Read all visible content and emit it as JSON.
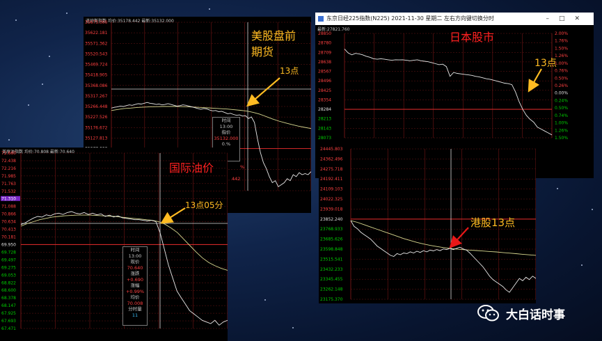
{
  "watermark": {
    "text": "大白话时事"
  },
  "colors": {
    "up": "#ff4040",
    "down": "#00d000",
    "price": "#e8e8e8",
    "avg": "#d8d890",
    "annotation": "#ffbb22",
    "arrow": "#ffbb22",
    "hk_arrow": "#e81818"
  },
  "chart_data": [
    {
      "id": "us_futures",
      "type": "line",
      "header": {
        "name": "道琼斯指数",
        "price_label": "均价:",
        "price": "35178.442",
        "latest_label": "最新:",
        "latest": "35132.000"
      },
      "annotation_title": "美股盘前期货",
      "annotation_title_lines": [
        "美股盘前",
        "期货"
      ],
      "annotation_marker": "13点",
      "y_ticks": [
        "35673.000",
        "35622.181",
        "35571.362",
        "35520.543",
        "35469.724",
        "35418.905",
        "35368.086",
        "35317.267",
        "35266.448",
        "35227.526",
        "35176.672",
        "35127.813",
        "35077.000",
        "35026.181",
        "34975.362",
        "34924.543",
        "34873.724"
      ],
      "reference_value": "35077.000",
      "ylim": [
        34850,
        35690
      ],
      "values": [
        35262,
        35266,
        35268,
        35272,
        35270,
        35274,
        35278,
        35276,
        35280,
        35284,
        35282,
        35286,
        35290,
        35286,
        35284,
        35280,
        35282,
        35278,
        35280,
        35284,
        35280,
        35276,
        35272,
        35274,
        35278,
        35276,
        35272,
        35268,
        35264,
        35260,
        35256,
        35260,
        35258,
        35252,
        35248,
        35250,
        35244,
        35246,
        35240,
        35234,
        35236,
        35230,
        35226,
        35228,
        35222,
        35224,
        35210,
        35218,
        35190,
        35110,
        35040,
        34990,
        34960,
        34920,
        34890,
        34900,
        34870,
        34880,
        34890,
        34910,
        34900,
        34930,
        34920,
        34940,
        34930,
        34935,
        34930,
        34945
      ],
      "avg": [
        35250,
        35255,
        35260,
        35262,
        35265,
        35267,
        35268,
        35269,
        35270,
        35270,
        35270,
        35269,
        35268,
        35267,
        35265,
        35263,
        35261,
        35259,
        35257,
        35254,
        35251,
        35247,
        35241,
        35232,
        35220,
        35208,
        35197,
        35188,
        35180,
        35172,
        35166,
        35160
      ],
      "info": {
        "time_label": "时间",
        "time": "13:00",
        "price_label": "指价",
        "price": "35132.000",
        "chg": "0.%"
      },
      "stray_labels": [
        "%",
        "442"
      ]
    },
    {
      "id": "nikkei",
      "type": "line",
      "window_title": "东京日经225指数(N225)  2021-11-30 星期二      左右方向键切换分时",
      "latest_label": "最新:",
      "latest": "27821.760",
      "annotation_title": "日本股市",
      "annotation_marker": "13点",
      "y_ticks_left": [
        "28850",
        "28780",
        "28709",
        "28638",
        "28567",
        "28496",
        "28425",
        "28354",
        "28284",
        "28213",
        "28143",
        "28073"
      ],
      "y_ticks_right": [
        "2.00%",
        "1.76%",
        "1.50%",
        "1.26%",
        "1.00%",
        "0.76%",
        "0.50%",
        "0.26%",
        "0.00%",
        "0.24%",
        "0.50%",
        "0.74%",
        "1.00%",
        "1.26%",
        "1.50%"
      ],
      "reference_value": "28284",
      "ylim": [
        27790,
        28860
      ],
      "values": [
        28700,
        28660,
        28640,
        28655,
        28650,
        28640,
        28625,
        28615,
        28600,
        28595,
        28600,
        28595,
        28590,
        28585,
        28590,
        28588,
        28590,
        28585,
        28580,
        28585,
        28590,
        28580,
        28575,
        28570,
        28560,
        28550,
        28540,
        28545,
        28520,
        28420,
        28460,
        28450,
        28445,
        28440,
        28435,
        28430,
        28420,
        28415,
        28405,
        28395,
        28390,
        28380,
        28370,
        28360,
        28350,
        28345,
        28335,
        28260,
        28160,
        28080,
        28020,
        27980,
        27950,
        27900,
        27880,
        27860,
        27840,
        27820
      ]
    },
    {
      "id": "oil",
      "type": "line",
      "header": {
        "name": "美原油指数",
        "price_label": "均价:",
        "price": "70.808",
        "latest_label": "最新:",
        "latest": "70.640"
      },
      "annotation_title": "国际油价",
      "annotation_marker": "13点05分",
      "y_ticks": [
        "72.660",
        "72.438",
        "72.216",
        "71.985",
        "71.763",
        "71.532",
        "71.310",
        "71.088",
        "70.866",
        "70.634",
        "70.413",
        "70.181",
        "69.950",
        "69.728",
        "69.497",
        "69.275",
        "69.053",
        "68.822",
        "68.600",
        "68.378",
        "68.147",
        "67.925",
        "67.693",
        "67.471"
      ],
      "reference_value": "69.950",
      "highlight_value": "71.310",
      "ylim": [
        67.35,
        72.75
      ],
      "values": [
        70.55,
        70.6,
        70.68,
        70.75,
        70.8,
        70.78,
        70.85,
        70.82,
        70.88,
        70.9,
        70.86,
        70.92,
        70.95,
        70.9,
        70.88,
        70.92,
        70.86,
        70.9,
        70.85,
        70.88,
        70.8,
        70.84,
        70.78,
        70.82,
        70.76,
        70.74,
        70.72,
        70.7,
        70.7,
        70.68,
        70.66,
        70.68,
        70.64,
        70.3,
        69.8,
        69.3,
        68.9,
        68.5,
        68.3,
        68.1,
        67.9,
        67.8,
        67.7,
        67.6,
        67.55,
        67.5,
        67.6,
        67.45,
        67.55,
        67.6
      ],
      "avg": [
        70.5,
        70.58,
        70.64,
        70.7,
        70.74,
        70.78,
        70.8,
        70.82,
        70.83,
        70.84,
        70.84,
        70.84,
        70.83,
        70.82,
        70.81,
        70.8,
        70.78,
        70.76,
        70.74,
        70.72,
        70.7,
        70.68,
        70.64,
        70.56,
        70.44,
        70.3,
        70.1,
        69.9,
        69.7,
        69.52,
        69.38,
        69.28,
        69.2,
        69.14
      ],
      "info": {
        "time_label": "时间",
        "time": "13:00",
        "price_label": "现价",
        "price": "70.640",
        "chg_label": "涨跌",
        "chg": "+0.690",
        "pct_label": "涨幅",
        "pct": "+0.99%",
        "avg_label": "均价",
        "avg": "70.008",
        "vol_label": "分时量",
        "vol": "11"
      }
    },
    {
      "id": "hk",
      "type": "line",
      "annotation_marker": "港股13点",
      "y_ticks": [
        "24445.803",
        "24362.496",
        "24275.718",
        "24192.411",
        "24109.103",
        "24022.325",
        "23939.018",
        "23852.240",
        "23768.933",
        "23685.626",
        "23598.848",
        "23515.541",
        "23432.233",
        "23345.455",
        "23262.148",
        "23175.370"
      ],
      "reference_value": "23852.240",
      "ylim": [
        23160,
        24460
      ],
      "values": [
        23840,
        23790,
        23770,
        23740,
        23720,
        23700,
        23680,
        23650,
        23620,
        23600,
        23580,
        23560,
        23540,
        23530,
        23555,
        23545,
        23560,
        23555,
        23570,
        23560,
        23575,
        23565,
        23580,
        23570,
        23585,
        23578,
        23590,
        23580,
        23595,
        23590,
        23600,
        23590,
        23600,
        23610,
        23595,
        23585,
        23560,
        23530,
        23500,
        23470,
        23440,
        23400,
        23360,
        23330,
        23310,
        23290,
        23270,
        23240,
        23220,
        23260,
        23300,
        23340,
        23320,
        23350,
        23330,
        23360,
        23340
      ],
      "avg": [
        23840,
        23825,
        23805,
        23785,
        23765,
        23745,
        23725,
        23705,
        23685,
        23668,
        23652,
        23638,
        23626,
        23616,
        23607,
        23600,
        23594,
        23589,
        23585,
        23581,
        23577,
        23573,
        23569,
        23564,
        23559,
        23554,
        23549,
        23544,
        23540
      ]
    }
  ]
}
